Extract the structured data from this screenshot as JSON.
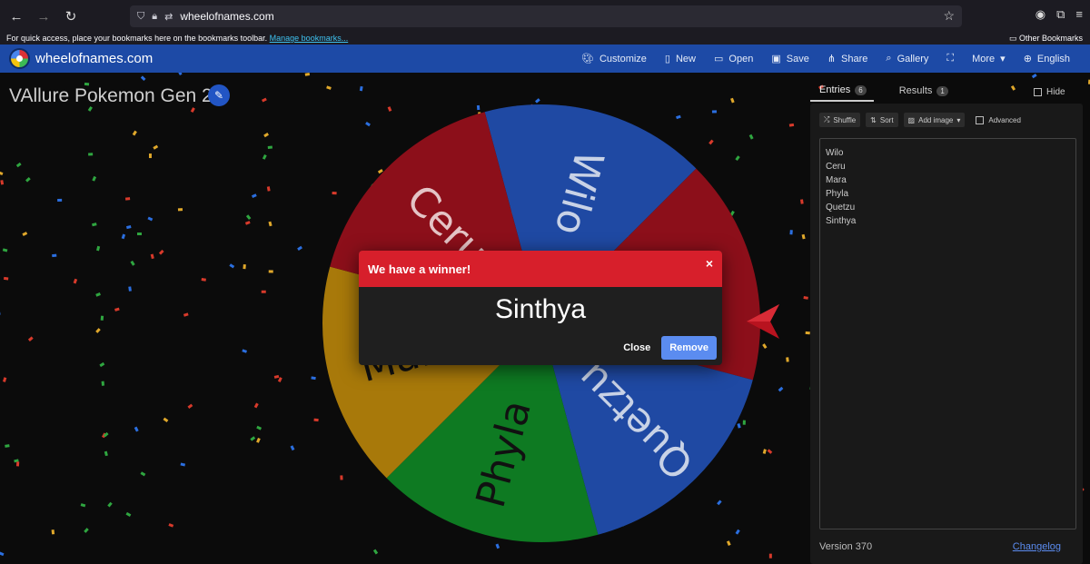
{
  "browser": {
    "url": "wheelofnames.com",
    "bookmarks_hint": "For quick access, place your bookmarks here on the bookmarks toolbar.",
    "manage_bookmarks": "Manage bookmarks...",
    "other_bookmarks": "Other Bookmarks"
  },
  "navbar": {
    "brand": "wheelofnames.com",
    "items": [
      {
        "label": "Customize",
        "icon": "palette-icon"
      },
      {
        "label": "New",
        "icon": "new-file-icon"
      },
      {
        "label": "Open",
        "icon": "folder-icon"
      },
      {
        "label": "Save",
        "icon": "save-icon"
      },
      {
        "label": "Share",
        "icon": "share-icon"
      },
      {
        "label": "Gallery",
        "icon": "search-icon"
      },
      {
        "label": "",
        "icon": "fullscreen-icon"
      },
      {
        "label": "More",
        "icon": "chevron-down-icon"
      },
      {
        "label": "English",
        "icon": "globe-icon"
      }
    ]
  },
  "title": "VAllure Pokemon Gen 2",
  "wheel": {
    "slices": [
      {
        "label": "Wilo",
        "color": "#1f49a3"
      },
      {
        "label": "Mara",
        "color": "#8c0f1a"
      },
      {
        "label": "Quetzu",
        "color": "#1f49a3"
      },
      {
        "label": "Phyla",
        "color": "#0e7a22"
      },
      {
        "label": "Mara",
        "color": "#a8790a"
      },
      {
        "label": "Ceru",
        "color": "#8c0f1a"
      }
    ],
    "pointer_color": "#b8131f"
  },
  "modal": {
    "header": "We have a winner!",
    "winner": "Sinthya",
    "close_label": "Close",
    "remove_label": "Remove",
    "header_color": "#d71f2b"
  },
  "sidebar": {
    "tabs": [
      {
        "label": "Entries",
        "count": "6"
      },
      {
        "label": "Results",
        "count": "1"
      }
    ],
    "hide_label": "Hide",
    "toolbar": {
      "shuffle": "Shuffle",
      "sort": "Sort",
      "add_image": "Add image",
      "advanced": "Advanced"
    },
    "entries": [
      "Wilo",
      "Ceru",
      "Mara",
      "Phyla",
      "Quetzu",
      "Sinthya"
    ],
    "version": "Version 370",
    "changelog": "Changelog"
  }
}
